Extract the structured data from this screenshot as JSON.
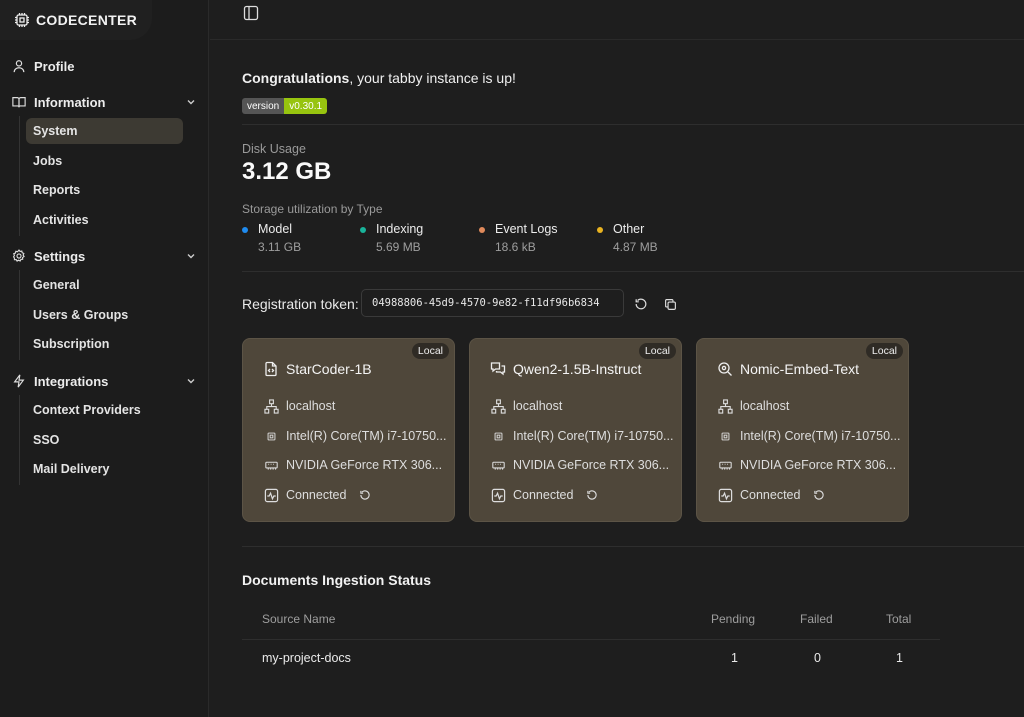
{
  "brand": {
    "name": "CODECENTER",
    "icon": "chip-icon"
  },
  "nav": {
    "profile": "Profile",
    "information": {
      "label": "Information",
      "items": [
        "System",
        "Jobs",
        "Reports",
        "Activities"
      ]
    },
    "settings": {
      "label": "Settings",
      "items": [
        "General",
        "Users & Groups",
        "Subscription"
      ]
    },
    "integrations": {
      "label": "Integrations",
      "items": [
        "Context Providers",
        "SSO",
        "Mail Delivery"
      ]
    },
    "active_item": "System"
  },
  "header": {
    "congrats_bold": "Congratulations",
    "congrats_rest": ", your tabby instance is up!",
    "version_key": "version",
    "version_value": "v0.30.1"
  },
  "disk": {
    "label": "Disk Usage",
    "value": "3.12 GB",
    "storage_label": "Storage utilization by Type",
    "types": [
      {
        "name": "Model",
        "value": "3.11 GB",
        "color": "#1f8bef"
      },
      {
        "name": "Indexing",
        "value": "5.69 MB",
        "color": "#19b39a"
      },
      {
        "name": "Event Logs",
        "value": "18.6 kB",
        "color": "#e08a5b"
      },
      {
        "name": "Other",
        "value": "4.87 MB",
        "color": "#e9b320"
      }
    ]
  },
  "registration": {
    "label": "Registration token:",
    "token": "04988806-45d9-4570-9e82-f11df96b6834"
  },
  "workers": [
    {
      "badge": "Local",
      "name": "StarCoder-1B",
      "icon": "code-file-icon",
      "host": "localhost",
      "cpu": "Intel(R) Core(TM) i7-10750...",
      "gpu": "NVIDIA GeForce RTX 306...",
      "status": "Connected"
    },
    {
      "badge": "Local",
      "name": "Qwen2-1.5B-Instruct",
      "icon": "chat-icon",
      "host": "localhost",
      "cpu": "Intel(R) Core(TM) i7-10750...",
      "gpu": "NVIDIA GeForce RTX 306...",
      "status": "Connected"
    },
    {
      "badge": "Local",
      "name": "Nomic-Embed-Text",
      "icon": "search-embed-icon",
      "host": "localhost",
      "cpu": "Intel(R) Core(TM) i7-10750...",
      "gpu": "NVIDIA GeForce RTX 306...",
      "status": "Connected"
    }
  ],
  "docs": {
    "title": "Documents Ingestion Status",
    "columns": [
      "Source Name",
      "Pending",
      "Failed",
      "Total"
    ],
    "rows": [
      {
        "source": "my-project-docs",
        "pending": "1",
        "failed": "0",
        "total": "1"
      }
    ]
  }
}
